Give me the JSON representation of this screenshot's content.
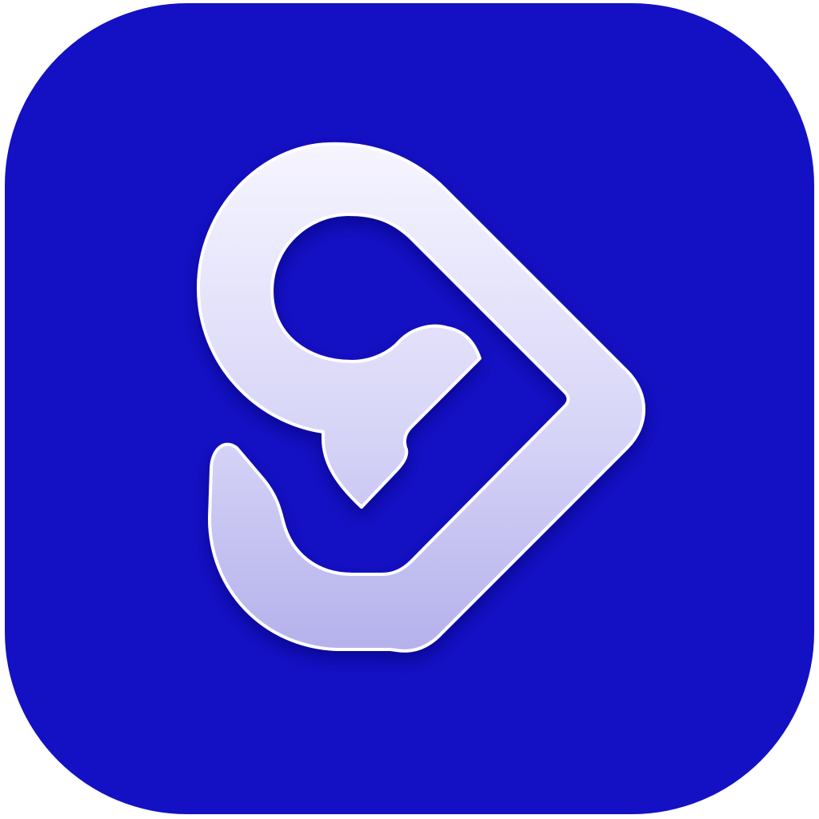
{
  "icon": {
    "name": "app-icon",
    "glyph": "heart-arrow-logo-icon",
    "colors": {
      "background": "#1410C4",
      "background_edge": "#2A26D6",
      "glyph_top": "#F6F5FF",
      "glyph_bottom": "#B4B1EC",
      "glyph_outline": "#FFFFFF",
      "glyph_shadow": "#07056E"
    }
  }
}
